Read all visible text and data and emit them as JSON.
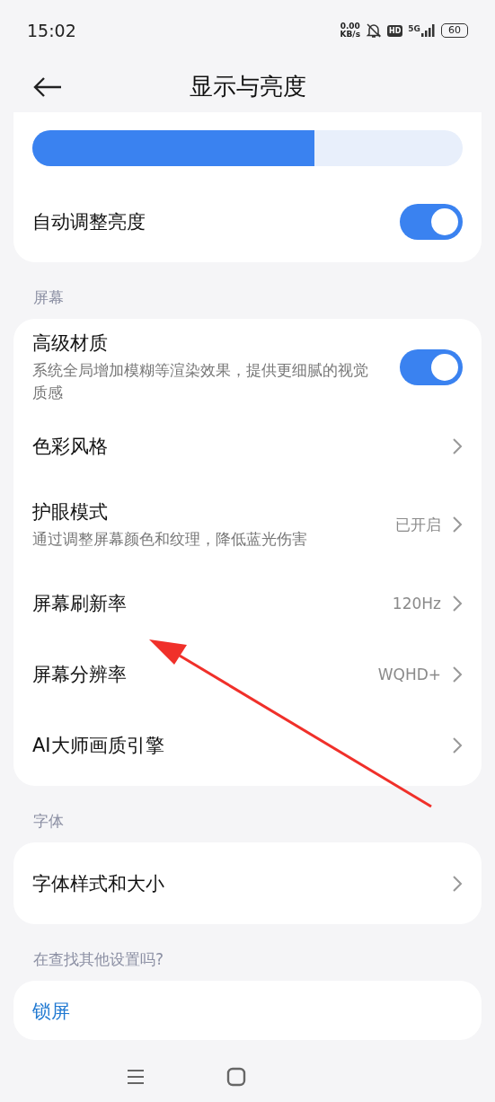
{
  "status_bar": {
    "time": "15:02",
    "speed_value": "0.00",
    "speed_unit": "KB/s",
    "hd_badge": "HD",
    "network": "5G",
    "battery": "60"
  },
  "header": {
    "title": "显示与亮度"
  },
  "brightness": {
    "level": 0.655,
    "auto": {
      "label": "自动调整亮度",
      "on": true
    }
  },
  "sections": [
    {
      "heading": "屏幕",
      "items": [
        {
          "kind": "toggle",
          "label": "高级材质",
          "description": "系统全局增加模糊等渲染效果，提供更细腻的视觉质感",
          "on": true
        },
        {
          "kind": "link",
          "label": "色彩风格"
        },
        {
          "kind": "link",
          "label": "护眼模式",
          "description": "通过调整屏幕颜色和纹理，降低蓝光伤害",
          "value": "已开启"
        },
        {
          "kind": "link",
          "label": "屏幕刷新率",
          "value": "120Hz"
        },
        {
          "kind": "link",
          "label": "屏幕分辨率",
          "value": "WQHD+"
        },
        {
          "kind": "link",
          "label": "AI大师画质引擎"
        }
      ]
    },
    {
      "heading": "字体",
      "items": [
        {
          "kind": "link",
          "label": "字体样式和大小"
        }
      ]
    },
    {
      "heading": "在查找其他设置吗?",
      "items": [
        {
          "kind": "suggestion",
          "label": "锁屏"
        }
      ]
    }
  ]
}
